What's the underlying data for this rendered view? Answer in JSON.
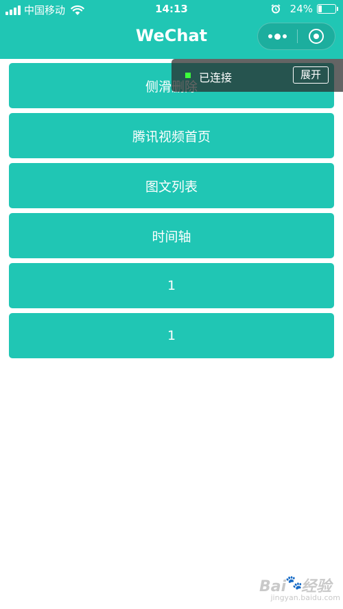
{
  "status_bar": {
    "carrier": "中国移动",
    "time": "14:13",
    "battery_percent": "24%",
    "battery_level": 0.24
  },
  "nav": {
    "title": "WeChat"
  },
  "menu": {
    "items": [
      {
        "label": "侧滑删除"
      },
      {
        "label": "腾讯视频首页"
      },
      {
        "label": "图文列表"
      },
      {
        "label": "时间轴"
      },
      {
        "label": "1"
      },
      {
        "label": "1"
      }
    ]
  },
  "vconsole": {
    "status": "已连接",
    "expand_label": "展开"
  },
  "watermark": {
    "logo": "Bai",
    "logo_tail": "经验",
    "site": "jingyan.baidu.com"
  },
  "colors": {
    "brand": "#20c6b4",
    "connected": "#3cff3c"
  }
}
